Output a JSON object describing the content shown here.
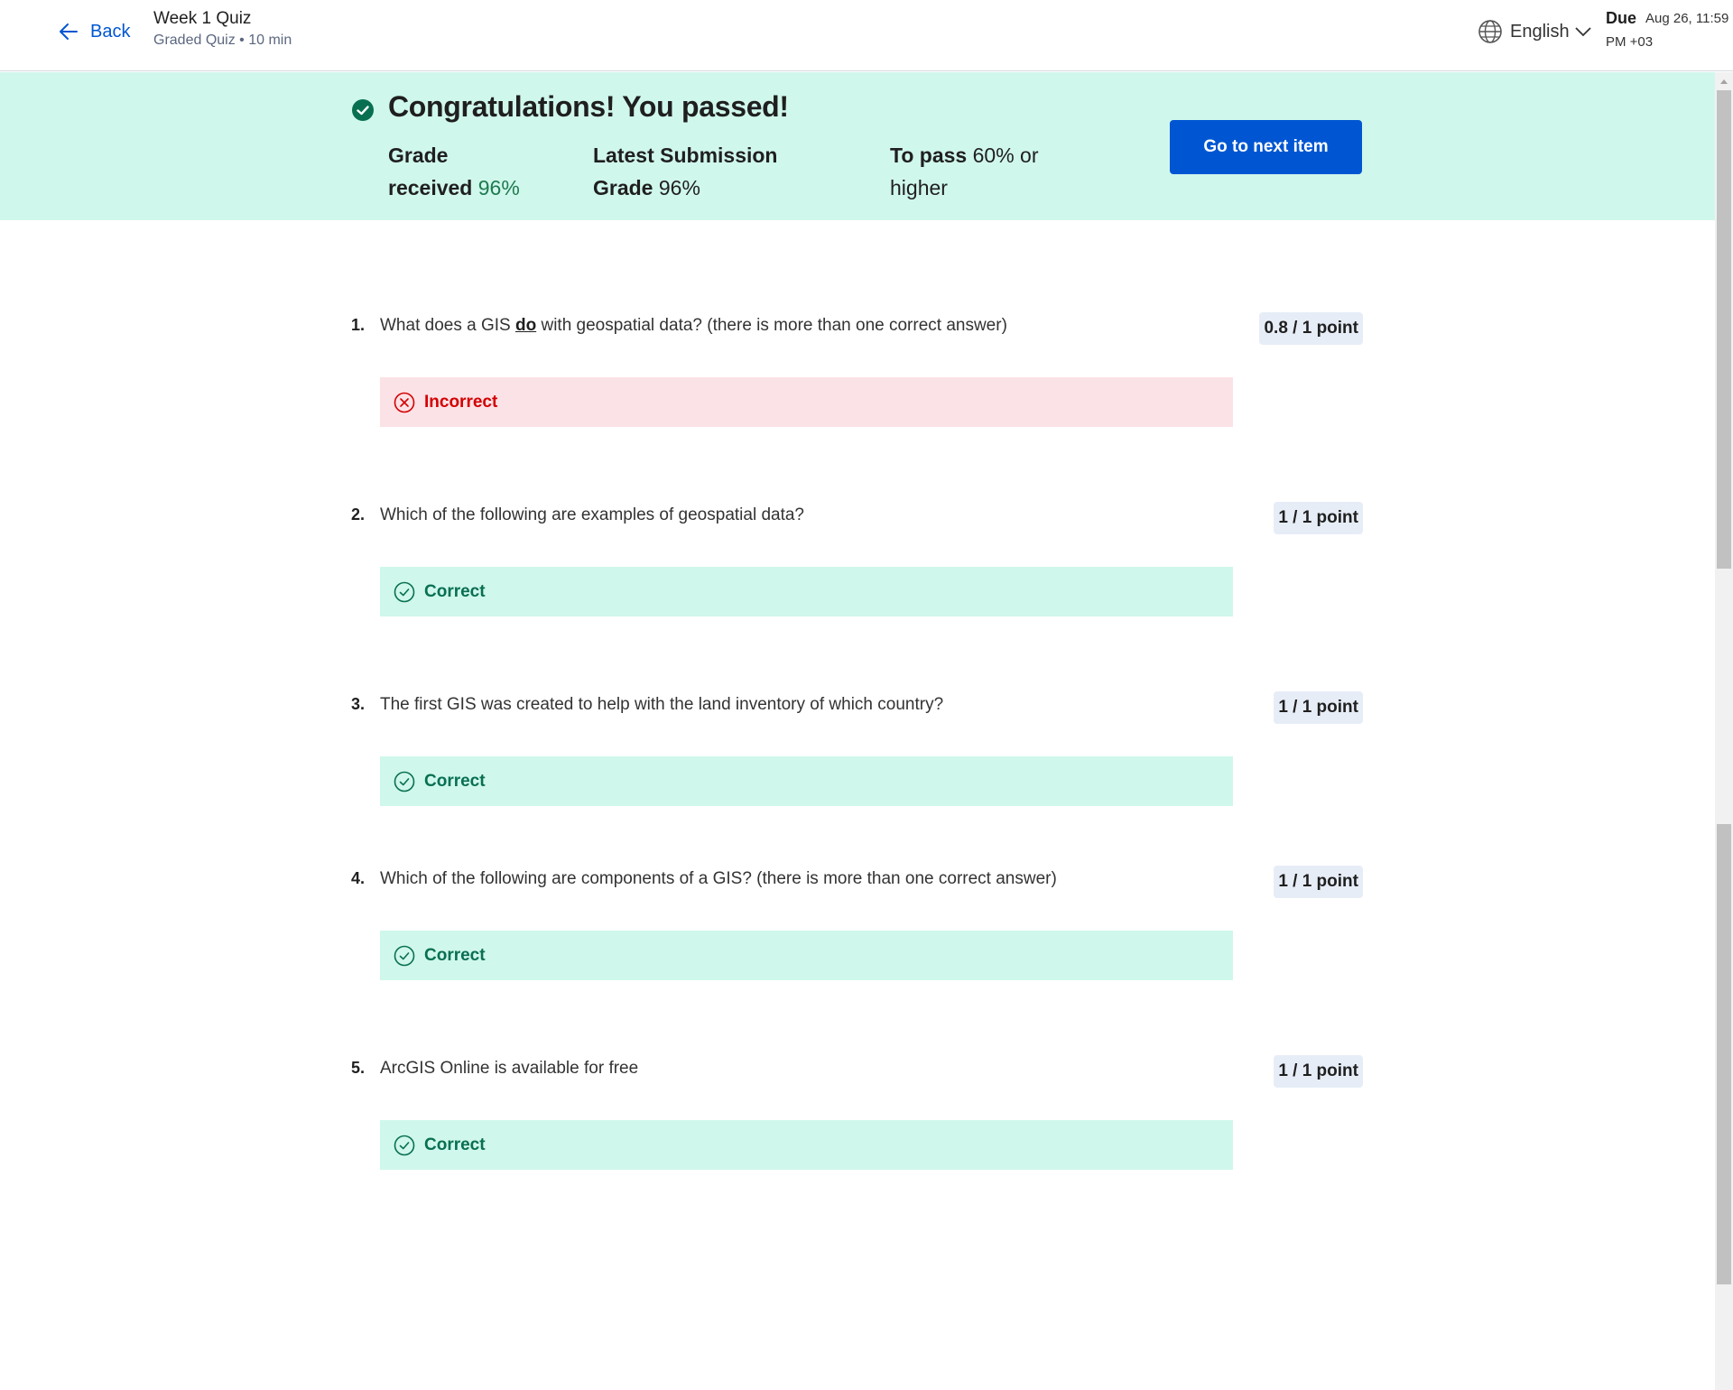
{
  "header": {
    "back_label": "Back",
    "quiz_title": "Week 1 Quiz",
    "quiz_subtitle": "Graded Quiz • 10 min",
    "language": "English",
    "due_label": "Due",
    "due_date": "Aug 26, 11:59",
    "due_time": "PM +03"
  },
  "banner": {
    "title": "Congratulations! You passed!",
    "grade_received_label": "Grade received",
    "grade_received_value": "96%",
    "latest_submission_label": "Latest Submission Grade",
    "latest_submission_value": "96%",
    "to_pass_label": "To pass",
    "to_pass_value": "60% or higher",
    "next_button": "Go to next item"
  },
  "questions": [
    {
      "number": "1.",
      "text_before": "What does a GIS ",
      "text_emphasis": "do",
      "text_after": " with geospatial data? (there is more than one correct answer)",
      "points": "0.8 / 1 point",
      "result": "Incorrect"
    },
    {
      "number": "2.",
      "text": "Which of the following are examples of geospatial data?",
      "points": "1 / 1 point",
      "result": "Correct"
    },
    {
      "number": "3.",
      "text": "The first GIS was created to help with the land inventory of which country?",
      "points": "1 / 1 point",
      "result": "Correct"
    },
    {
      "number": "4.",
      "text": "Which of the following are components of a GIS? (there is more than one correct answer)",
      "points": "1 / 1 point",
      "result": "Correct"
    },
    {
      "number": "5.",
      "text": "ArcGIS Online is available for free",
      "points": "1 / 1 point",
      "result": "Correct"
    }
  ],
  "colors": {
    "brand_blue": "#0056d2",
    "success_bg": "#d0f7ec",
    "success_text": "#087051",
    "error_bg": "#fbe2e6",
    "error_text": "#d30001"
  },
  "icons": {
    "back": "arrow-left-icon",
    "language": "globe-icon",
    "language_caret": "chevron-down-icon",
    "passed": "check-circle-filled-icon",
    "correct": "check-circle-outline-icon",
    "incorrect": "x-circle-outline-icon"
  }
}
